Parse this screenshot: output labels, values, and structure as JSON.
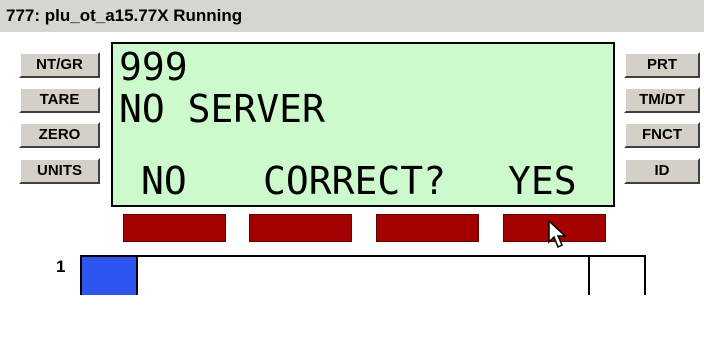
{
  "window": {
    "title": "777: plu_ot_a15.77X Running"
  },
  "left_buttons": [
    "NT/GR",
    "TARE",
    "ZERO",
    "UNITS"
  ],
  "right_buttons": [
    "PRT",
    "TM/DT",
    "FNCT",
    "ID"
  ],
  "display": {
    "line1": "999",
    "line2": "NO SERVER",
    "prompt_no": "NO",
    "prompt_question": "CORRECT?",
    "prompt_yes": "YES",
    "background": "#ccfacc"
  },
  "softkeys": {
    "count": 4,
    "color": "#a30000"
  },
  "scale": {
    "number": "1",
    "fill_color": "#2e55f0"
  }
}
